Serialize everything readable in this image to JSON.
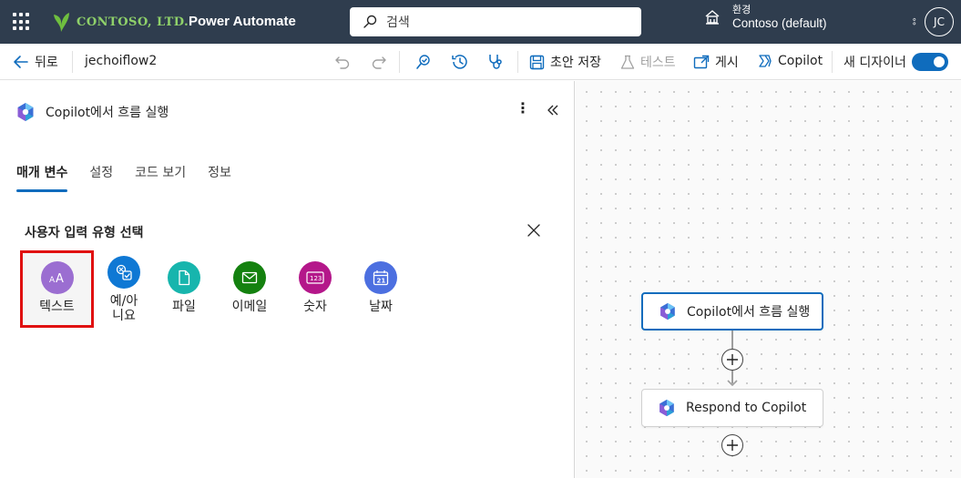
{
  "header": {
    "logo_text": "CONTOSO, LTD.",
    "app_name": "Power Automate",
    "search_placeholder": "검색",
    "env_label": "환경",
    "env_name": "Contoso (default)",
    "more": "⦂",
    "avatar_initials": "JC"
  },
  "toolbar": {
    "back_label": "뒤로",
    "flow_name": "jechoiflow2",
    "save_draft_label": "초안 저장",
    "test_label": "테스트",
    "publish_label": "게시",
    "copilot_label": "Copilot",
    "new_designer_label": "새 디자이너",
    "new_designer_on": true
  },
  "panel": {
    "title": "Copilot에서 흐름 실행",
    "tabs": [
      {
        "label": "매개 변수",
        "active": true
      },
      {
        "label": "설정",
        "active": false
      },
      {
        "label": "코드 보기",
        "active": false
      },
      {
        "label": "정보",
        "active": false
      }
    ],
    "section_title": "사용자 입력 유형 선택",
    "input_types": [
      {
        "label": "텍스트",
        "icon": "text-icon",
        "color": "#9b6ed1",
        "selected": true
      },
      {
        "label": "예/아\n니요",
        "icon": "yes-no-icon",
        "color": "#0f78d4",
        "selected": false
      },
      {
        "label": "파일",
        "icon": "file-icon",
        "color": "#17b5ad",
        "selected": false
      },
      {
        "label": "이메일",
        "icon": "email-icon",
        "color": "#14810f",
        "selected": false
      },
      {
        "label": "숫자",
        "icon": "number-icon",
        "color": "#b4178a",
        "selected": false
      },
      {
        "label": "날짜",
        "icon": "date-icon",
        "color": "#4c6fe0",
        "selected": false
      }
    ]
  },
  "canvas": {
    "nodes": [
      {
        "label": "Copilot에서 흐름 실행",
        "icon": "copilot-icon",
        "active": true
      },
      {
        "label": "Respond to Copilot",
        "icon": "copilot-icon",
        "active": false
      }
    ]
  },
  "colors": {
    "header_bg": "#2f3d4e",
    "accent": "#0f6cbd",
    "selection_border": "#e01010"
  }
}
